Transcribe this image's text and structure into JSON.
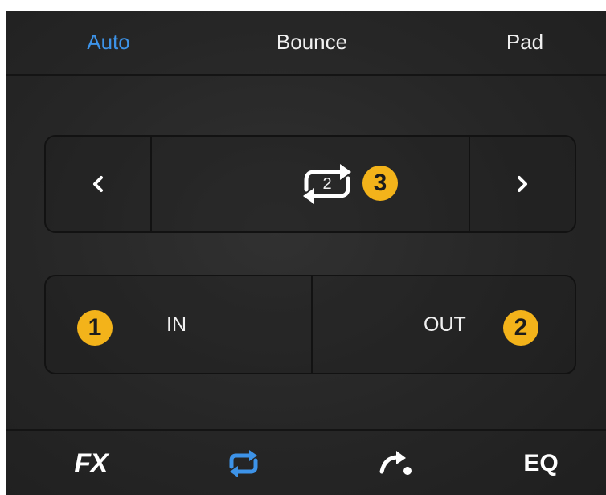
{
  "tabs": [
    {
      "label": "Auto",
      "active": true
    },
    {
      "label": "Bounce",
      "active": false
    },
    {
      "label": "Pad",
      "active": false
    }
  ],
  "loop": {
    "prev_icon": "chevron-left-icon",
    "next_icon": "chevron-right-icon",
    "loop_icon": "loop-icon",
    "count": "2"
  },
  "inout": {
    "in_label": "IN",
    "out_label": "OUT"
  },
  "callouts": [
    "1",
    "2",
    "3"
  ],
  "bottom_bar": {
    "fx_label": "FX",
    "loop_icon": "loop-icon",
    "roll_icon": "roll-icon",
    "eq_label": "EQ"
  },
  "colors": {
    "accent": "#3d93e8",
    "badge": "#f3b31a",
    "background": "#262626",
    "text": "#f0f0f0"
  }
}
